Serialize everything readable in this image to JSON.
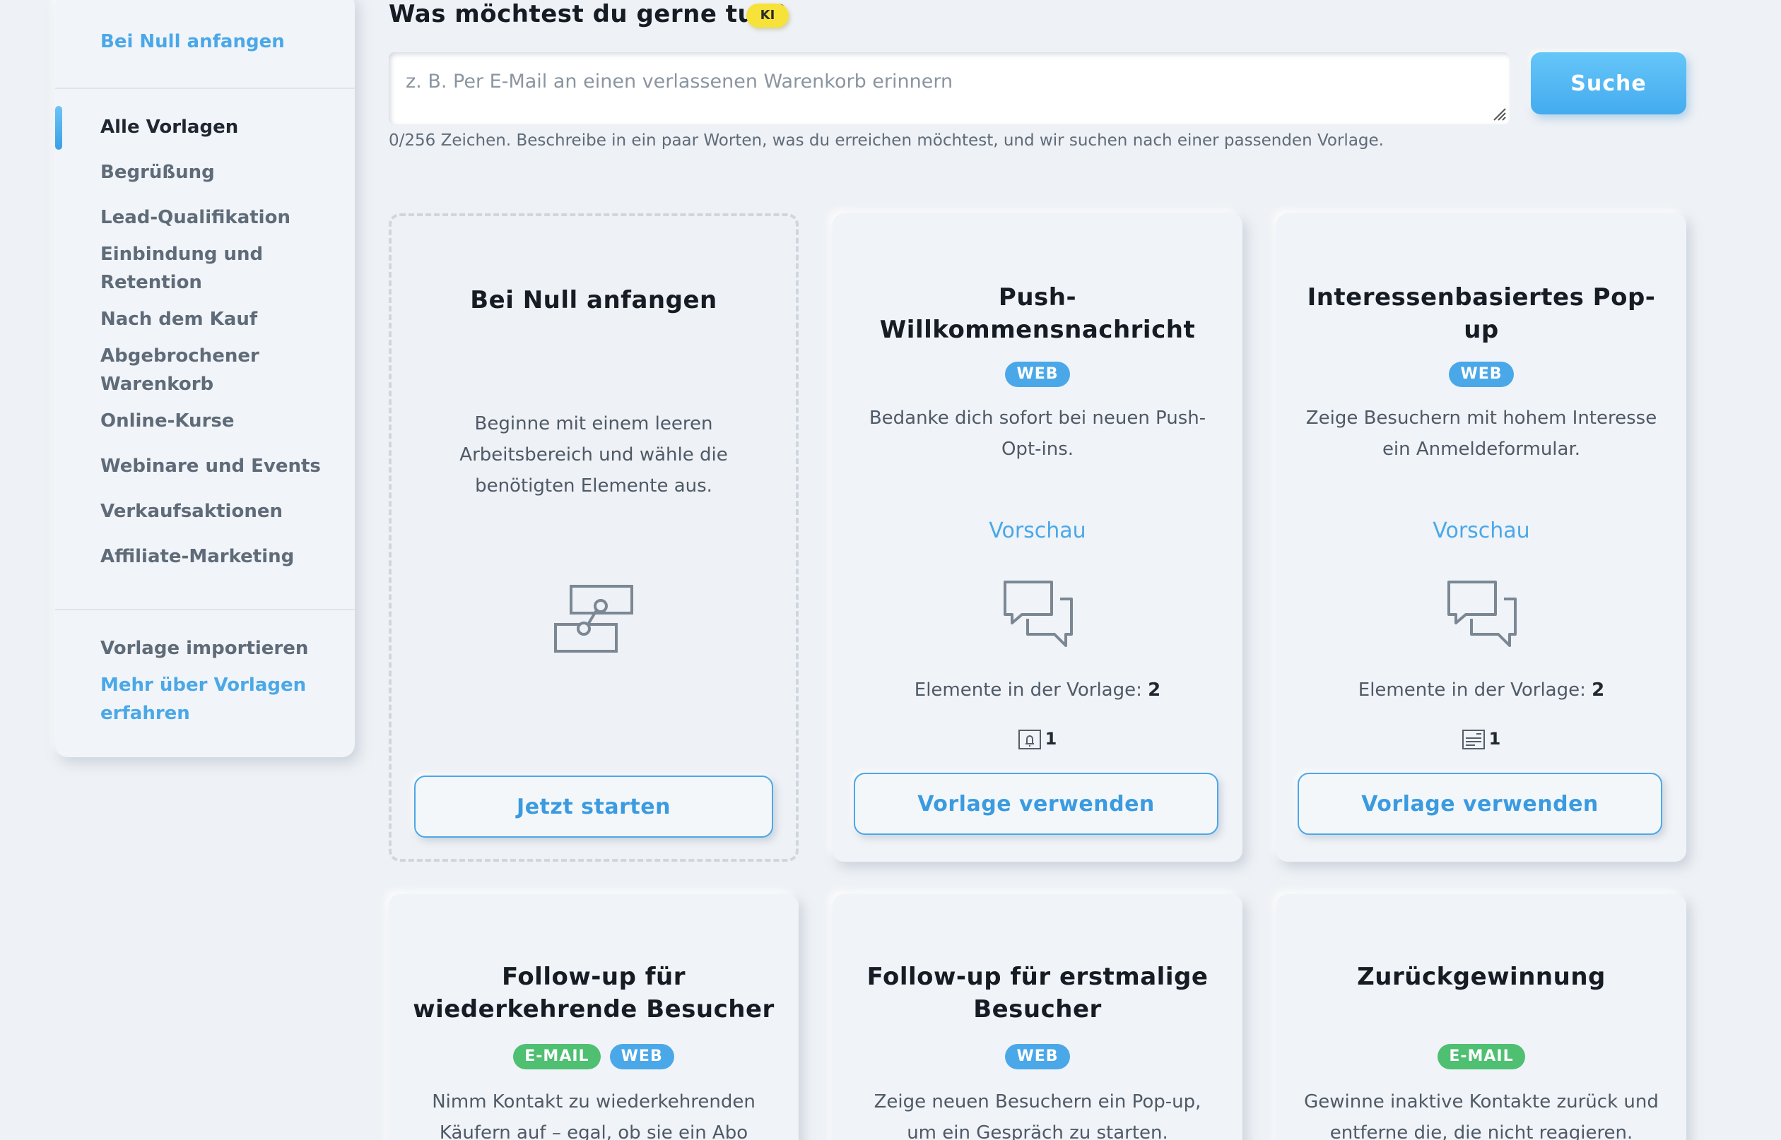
{
  "sidebar": {
    "top_link": "Bei Null anfangen",
    "categories": [
      {
        "label": "Alle Vorlagen",
        "active": true
      },
      {
        "label": "Begrüßung"
      },
      {
        "label": "Lead-Qualifikation"
      },
      {
        "label": "Einbindung und Retention"
      },
      {
        "label": "Nach dem Kauf"
      },
      {
        "label": "Abgebrochener Warenkorb"
      },
      {
        "label": "Online-Kurse"
      },
      {
        "label": "Webinare und Events"
      },
      {
        "label": "Verkaufsaktionen"
      },
      {
        "label": "Affiliate-Marketing"
      }
    ],
    "import_label": "Vorlage importieren",
    "learn_more_label": "Mehr über Vorlagen erfahren"
  },
  "search": {
    "question": "Was möchtest du gerne tun?",
    "ai_badge": "KI",
    "placeholder": "z. B. Per E-Mail an einen verlassenen Warenkorb erinnern",
    "value": "",
    "button_label": "Suche",
    "hint": "0/256 Zeichen. Beschreibe in ein paar Worten, was du erreichen möchtest, und wir suchen nach einer passenden Vorlage."
  },
  "templates": [
    {
      "title": "Bei Null anfangen",
      "description": "Beginne mit einem leeren Arbeitsbereich und wähle die benötigten Elemente aus.",
      "icon": "flow-diagram-icon",
      "button_label": "Jetzt starten"
    },
    {
      "title": "Push-Willkommensnachricht",
      "channels": [
        "WEB"
      ],
      "description": "Bedanke dich sofort bei neuen Push-Opt-ins.",
      "preview_label": "Vorschau",
      "icon": "chat-bubbles-icon",
      "elements_label": "Elemente in der Vorlage:",
      "elements_count": "2",
      "element_icon": "push-bell-icon",
      "element_icon_count": "1",
      "button_label": "Vorlage verwenden"
    },
    {
      "title": "Interessenbasiertes Pop-up",
      "channels": [
        "WEB"
      ],
      "description": "Zeige Besuchern mit hohem Interesse ein Anmeldeformular.",
      "preview_label": "Vorschau",
      "icon": "chat-bubbles-icon",
      "elements_label": "Elemente in der Vorlage:",
      "elements_count": "2",
      "element_icon": "popup-form-icon",
      "element_icon_count": "1",
      "button_label": "Vorlage verwenden"
    },
    {
      "title": "Follow-up für wiederkehrende Besucher",
      "channels": [
        "E-MAIL",
        "WEB"
      ],
      "description": "Nimm Kontakt zu wiederkehrenden Käufern auf – egal, ob sie ein Abo haben"
    },
    {
      "title": "Follow-up für erstmalige Besucher",
      "channels": [
        "WEB"
      ],
      "description": "Zeige neuen Besuchern ein Pop-up, um ein Gespräch zu starten."
    },
    {
      "title": "Zurückgewinnung",
      "channels": [
        "E-MAIL"
      ],
      "description": "Gewinne inaktive Kontakte zurück und entferne die, die nicht reagieren."
    }
  ],
  "colors": {
    "accent": "#4aa8e8",
    "web_badge": "#4aa8e8",
    "email_badge": "#4fbf72",
    "ai_badge": "#f7e23a",
    "background": "#eef1f5"
  }
}
